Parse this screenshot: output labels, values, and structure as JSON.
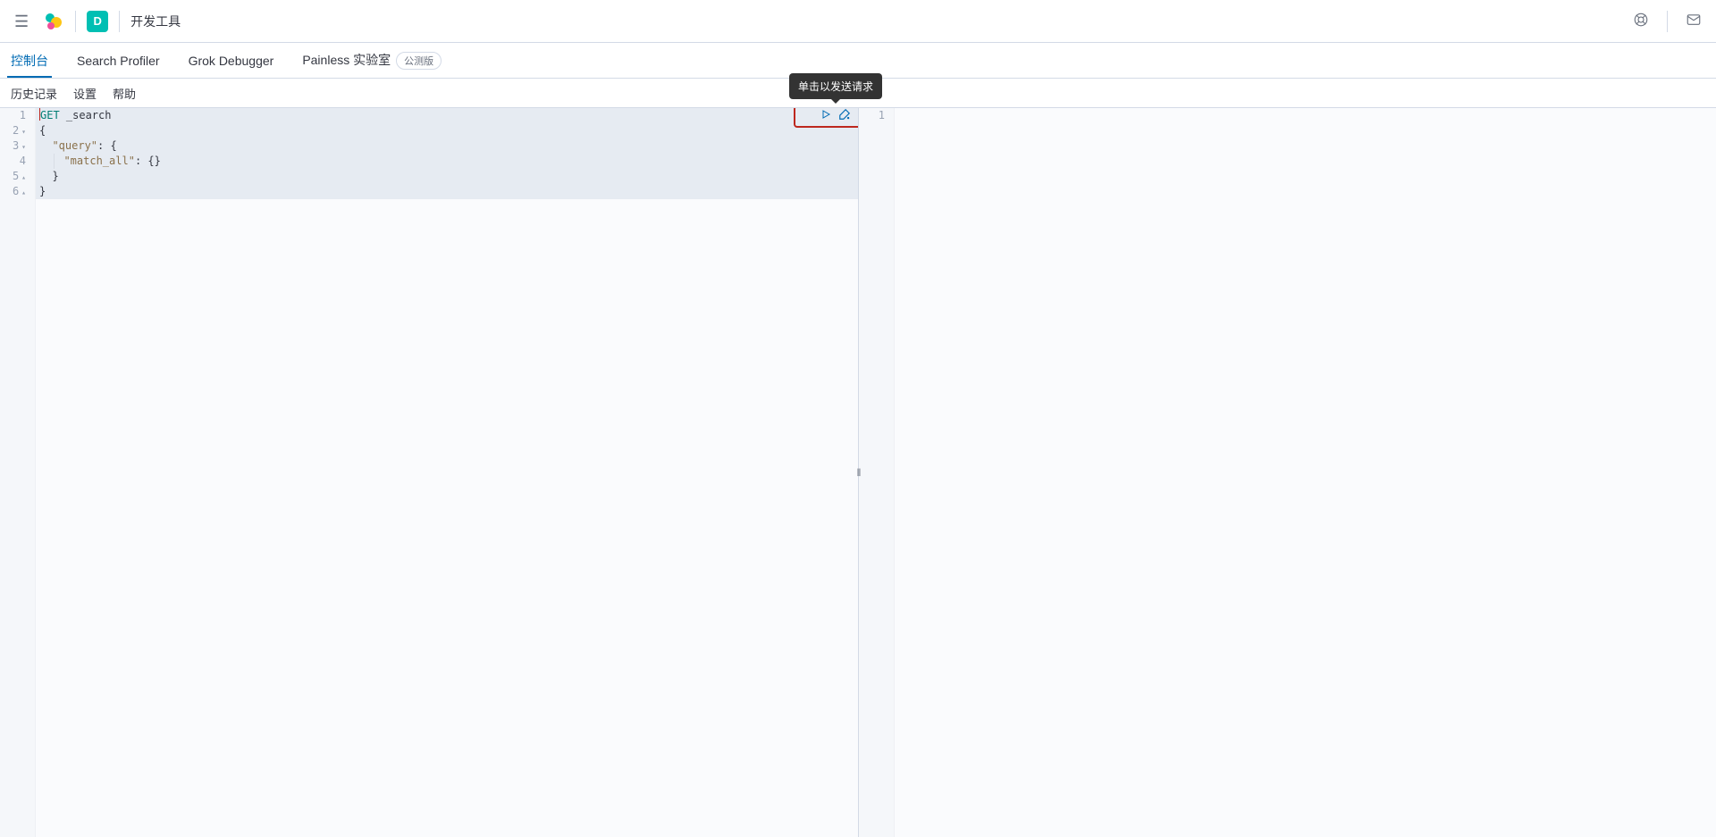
{
  "header": {
    "space_letter": "D",
    "breadcrumb": "开发工具"
  },
  "tabs": [
    {
      "label": "控制台",
      "active": true
    },
    {
      "label": "Search Profiler",
      "active": false
    },
    {
      "label": "Grok Debugger",
      "active": false
    },
    {
      "label": "Painless 实验室",
      "active": false,
      "badge": "公测版"
    }
  ],
  "subbar": {
    "history": "历史记录",
    "settings": "设置",
    "help": "帮助"
  },
  "tooltip": "单击以发送请求",
  "editor_request": {
    "lines": [
      {
        "num": "1",
        "fold": "",
        "tokens": [
          {
            "cls": "method",
            "t": "GET"
          },
          {
            "cls": "",
            "t": " _search"
          }
        ],
        "cursor_before": true
      },
      {
        "num": "2",
        "fold": "fold",
        "tokens": [
          {
            "cls": "punct",
            "t": "{"
          }
        ]
      },
      {
        "num": "3",
        "fold": "fold",
        "tokens": [
          {
            "cls": "indent",
            "t": ""
          },
          {
            "cls": "key",
            "t": "\"query\""
          },
          {
            "cls": "punct",
            "t": ": {"
          }
        ]
      },
      {
        "num": "4",
        "fold": "",
        "tokens": [
          {
            "cls": "indent",
            "t": ""
          },
          {
            "cls": "guide",
            "t": ""
          },
          {
            "cls": "key",
            "t": "\"match_all\""
          },
          {
            "cls": "punct",
            "t": ": {}"
          }
        ]
      },
      {
        "num": "5",
        "fold": "foldup",
        "tokens": [
          {
            "cls": "indent",
            "t": ""
          },
          {
            "cls": "punct",
            "t": "}"
          }
        ]
      },
      {
        "num": "6",
        "fold": "foldup",
        "tokens": [
          {
            "cls": "punct",
            "t": "}"
          }
        ]
      }
    ]
  },
  "editor_response": {
    "lines": [
      {
        "num": "1"
      }
    ]
  }
}
